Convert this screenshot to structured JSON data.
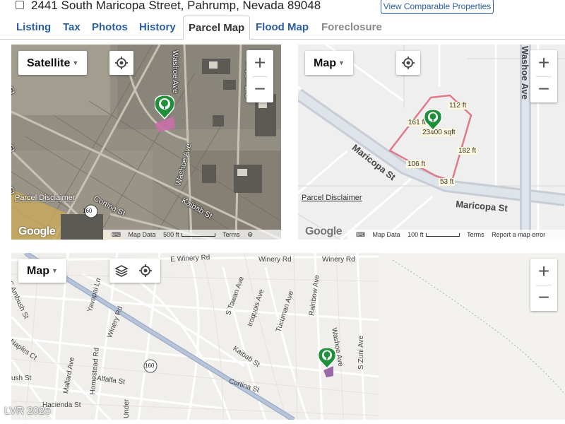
{
  "header": {
    "address": "2441 South Maricopa Street, Pahrump, Nevada 89048",
    "comparable_button": "View Comparable Properties"
  },
  "tabs": [
    {
      "label": "Listing",
      "state": "link"
    },
    {
      "label": "Tax",
      "state": "link"
    },
    {
      "label": "Photos",
      "state": "link"
    },
    {
      "label": "History",
      "state": "link"
    },
    {
      "label": "Parcel Map",
      "state": "active"
    },
    {
      "label": "Flood Map",
      "state": "link"
    },
    {
      "label": "Foreclosure",
      "state": "disabled"
    }
  ],
  "colors": {
    "link": "#2a5ea6",
    "marker": "#1f8f3a",
    "parcel": "#d36d86",
    "satellite": "#8f8a7f"
  },
  "map_satellite": {
    "type_label": "Satellite",
    "zoom_in": "+",
    "zoom_out": "−",
    "disclaimer": "Parcel Disclaimer",
    "logo": "Google",
    "map_data": "Map Data",
    "scale": "500 ft",
    "terms": "Terms",
    "route_shield": "160",
    "streets": [
      "Washoe Ave",
      "S Zuni Ave",
      "Cortina St",
      "Kaibab St",
      "Washoe Ave",
      "St",
      "St",
      "St"
    ]
  },
  "map_parcel": {
    "type_label": "Map",
    "zoom_in": "+",
    "zoom_out": "−",
    "disclaimer": "Parcel Disclaimer",
    "logo": "Google",
    "map_data": "Map Data",
    "scale": "100 ft",
    "terms": "Terms",
    "report": "Report a map error",
    "dimensions": [
      "112 ft",
      "161 ft",
      "182 ft",
      "106 ft",
      "53 ft"
    ],
    "area": "23400 sqft",
    "streets": [
      "Maricopa St",
      "Maricopa St",
      "Washoe Ave"
    ]
  },
  "map_area": {
    "type_label": "Map",
    "zoom_in": "+",
    "zoom_out": "−",
    "route_shield": "160",
    "streets": [
      "E Winery Rd",
      "Winery Rd",
      "Winery Rd",
      "S Ambush St",
      "Yavapai Ln",
      "Winery Rd",
      "S Tawan Ave",
      "Iroquois Ave",
      "Tucuman Ave",
      "Rainbow Ave",
      "Washoe Ave",
      "S Zuni Ave",
      "Kaibab St",
      "Naples Ct",
      "Mallard Ave",
      "Homestead Rd",
      "Alfalfa St",
      "Cortina St",
      "ush St",
      "Hacienda St",
      "Under"
    ]
  },
  "watermark": "LVR 2025"
}
